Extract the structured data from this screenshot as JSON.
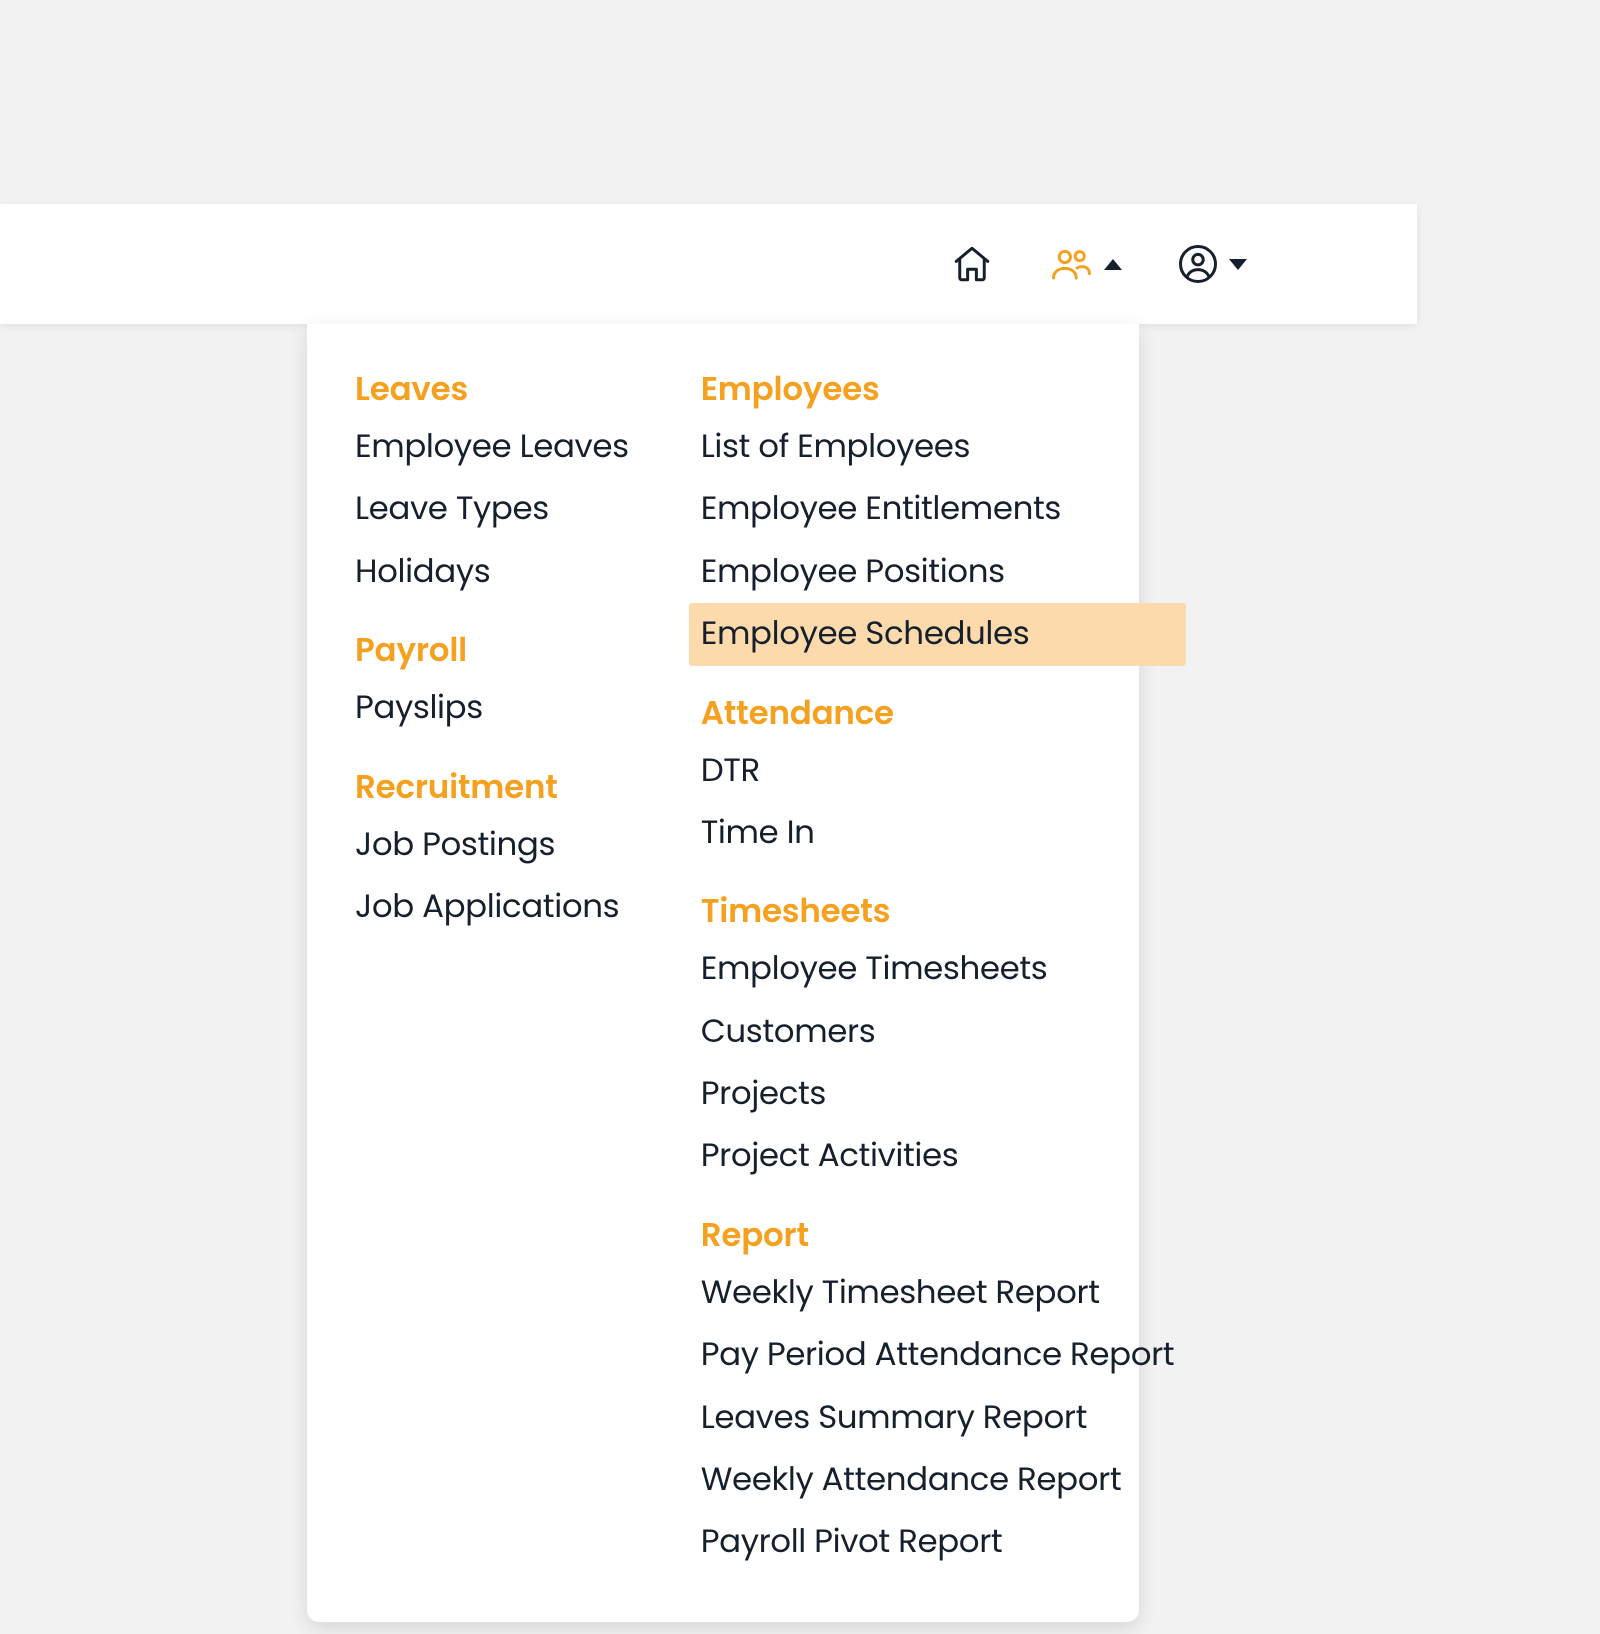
{
  "colors": {
    "accent": "#f5a01f",
    "text": "#16202c",
    "highlight_bg": "#fcdaab"
  },
  "menu": {
    "left": [
      {
        "header": "Leaves",
        "items": [
          "Employee Leaves",
          "Leave Types",
          "Holidays"
        ]
      },
      {
        "header": "Payroll",
        "items": [
          "Payslips"
        ]
      },
      {
        "header": "Recruitment",
        "items": [
          "Job Postings",
          "Job Applications"
        ]
      }
    ],
    "right": [
      {
        "header": "Employees",
        "items": [
          "List of Employees",
          "Employee Entitlements",
          "Employee Positions",
          "Employee Schedules"
        ]
      },
      {
        "header": "Attendance",
        "items": [
          "DTR",
          "Time In"
        ]
      },
      {
        "header": "Timesheets",
        "items": [
          "Employee Timesheets",
          "Customers",
          "Projects",
          "Project Activities"
        ]
      },
      {
        "header": "Report",
        "items": [
          "Weekly Timesheet Report",
          "Pay Period Attendance Report",
          "Leaves Summary Report",
          "Weekly Attendance Report",
          "Payroll Pivot Report"
        ]
      }
    ],
    "highlighted_item": "Employee Schedules"
  }
}
